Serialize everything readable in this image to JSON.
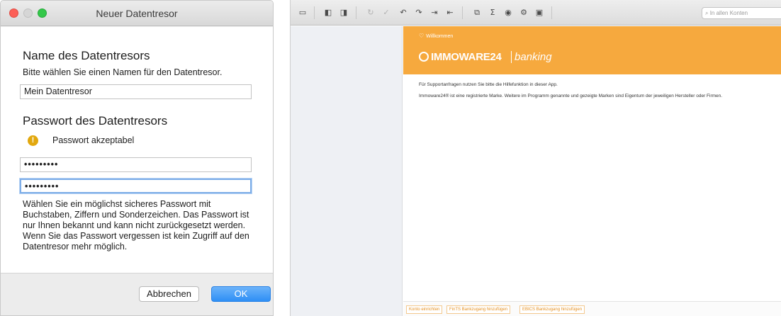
{
  "dialog": {
    "title": "Neuer Datentresor",
    "name_heading": "Name des Datentresors",
    "name_hint": "Bitte wählen Sie einen Namen für den Datentresor.",
    "name_value": "Mein Datentresor",
    "password_heading": "Passwort des Datentresors",
    "password_status": "Passwort akzeptabel",
    "password_value": "•••••••••",
    "password_confirm_value": "•••••••••",
    "help_text": "Wählen Sie ein möglichst sicheres Passwort mit Buchstaben, Ziffern und Sonderzeichen. Das Passwort ist nur Ihnen bekannt und kann nicht zurückgesetzt werden. Wenn Sie das Passwort vergessen ist kein Zugriff auf den Datentresor mehr möglich.",
    "cancel_label": "Abbrechen",
    "ok_label": "OK",
    "warning_icon_glyph": "!",
    "accent_color": "#2e8ff5",
    "warning_color": "#e2a80e"
  },
  "app": {
    "search_placeholder": "In allen Konten",
    "welcome_label": "Willkommen",
    "logo_brand": "IMMOWARE24",
    "logo_product": "banking",
    "support_text": "Für Supportanfragen nutzen Sie bitte die Hilfefunktion in dieser App.",
    "trademark_text": "Immoware24® ist eine registrierte Marke. Weitere im Programm genannte und gezeigte Marken sind Eigentum der jeweiligen Hersteller oder Firmen.",
    "bottom_links": {
      "konto": "Konto einrichten",
      "fints": "FinTS Bankzugang hinzufügen",
      "ebics": "EBICS Bankzugang hinzufügen"
    },
    "banner_color": "#f6a93e",
    "toolbar_icons": {
      "sidebar": "▭",
      "panel_left": "◧",
      "panel_right": "◨",
      "refresh": "↻",
      "check": "✓",
      "undo": "↶",
      "redo": "↷",
      "import": "⇥",
      "export": "⇤",
      "group": "⧉",
      "sum": "Σ",
      "user": "◉",
      "settings": "⚙",
      "print": "▣"
    }
  }
}
